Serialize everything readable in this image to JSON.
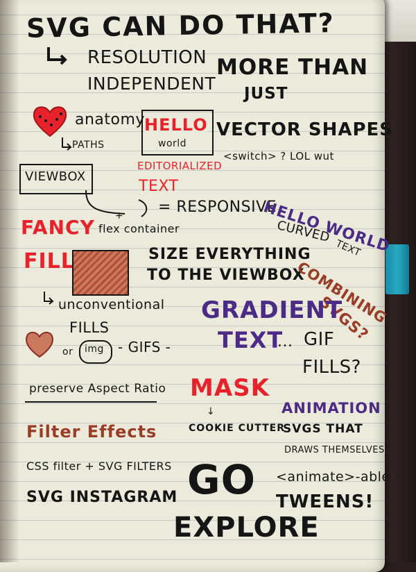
{
  "title": "SVG CAN DO THAT?",
  "notes": {
    "resolution": "RESOLUTION",
    "independent": "INDEPENDENT",
    "more_than": "MORE THAN",
    "just": "JUST",
    "anatomy": "anatomy",
    "paths": "PATHS",
    "hello": "HELLO",
    "world": "world",
    "vector_shapes": "VECTOR SHAPES",
    "switch": "<switch> ? LOL wut",
    "viewbox": "VIEWBOX",
    "editorialized": "EDITORIALIZED",
    "text": "TEXT",
    "plus": "+",
    "responsive": "= RESPONSIVE",
    "flex_container": "flex container",
    "hello_world": "HELLO WORLD",
    "curved": "CURVED",
    "curved_text": "TEXT",
    "fancy": "FANCY",
    "fills": "FILLS",
    "size_everything": "SIZE EVERYTHING",
    "to_the_viewbox": "TO THE VIEWBOX",
    "combining": "COMBINING",
    "svgs": "SVGS?",
    "unconventional": "unconventional",
    "fills2": "FILLS",
    "or_img": "or",
    "img": "img",
    "gifs": "- GIFS -",
    "gradient": "GRADIENT",
    "gradient_text": "TEXT",
    "ellipsis": "...",
    "gif": "GIF",
    "fills3": "FILLS?",
    "preserve": "preserve Aspect Ratio",
    "mask": "MASK",
    "cookie_cutter": "COOKIE CUTTER",
    "animation": "ANIMATION",
    "svgs_that": "SVGS THAT",
    "draws_themselves": "DRAWS THEMSELVES",
    "filter_effects": "Filter Effects",
    "css_filter": "CSS filter + SVG FILTERS",
    "svg_instagram": "SVG INSTAGRAM",
    "go": "GO",
    "explore": "EXPLORE",
    "animate_able": "<animate>-able",
    "tweens": "TWEENS!"
  },
  "colors": {
    "ink": "#151515",
    "red": "#e8222b",
    "brown": "#9a3c26",
    "purple": "#4b2b86",
    "ribbon": "#27a9c3"
  }
}
